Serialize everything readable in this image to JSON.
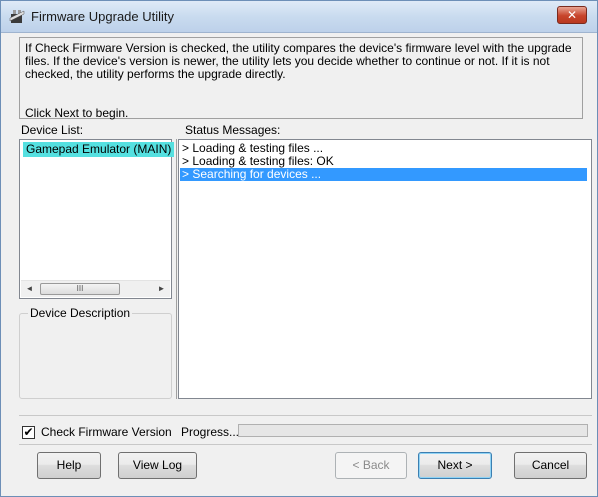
{
  "window": {
    "title": "Firmware Upgrade Utility",
    "close_label": "✕"
  },
  "info": {
    "text": "If Check Firmware Version is checked, the utility compares the device's firmware level with the upgrade files. If the device's version is newer, the utility lets you decide whether to continue or not. If it is not checked, the utility performs the upgrade directly.",
    "begin": "Click Next to begin."
  },
  "device_list": {
    "label": "Device List:",
    "items": [
      "Gamepad Emulator (MAIN)"
    ],
    "scroll_left": "◄",
    "scroll_right": "►",
    "scroll_thumb": "III"
  },
  "device_description": {
    "label": "Device Description"
  },
  "status": {
    "label": "Status Messages:",
    "lines": [
      "> Loading & testing files ...",
      "> Loading & testing files: OK",
      "> Searching for devices ..."
    ],
    "selected_index": 2
  },
  "options": {
    "check_firmware_label": "Check Firmware Version",
    "check_firmware_checked": true,
    "check_mark": "✔",
    "progress_label": "Progress...",
    "progress_fraction": 0.0
  },
  "buttons": {
    "help": "Help",
    "view_log": "View Log",
    "back": "< Back",
    "next": "Next >",
    "cancel": "Cancel"
  },
  "colors": {
    "selected_device_bg": "#55e0e0",
    "selected_status_bg": "#3399ff",
    "close_button": "#c7442b"
  },
  "icons": {
    "app": "firmware-chip-icon"
  }
}
